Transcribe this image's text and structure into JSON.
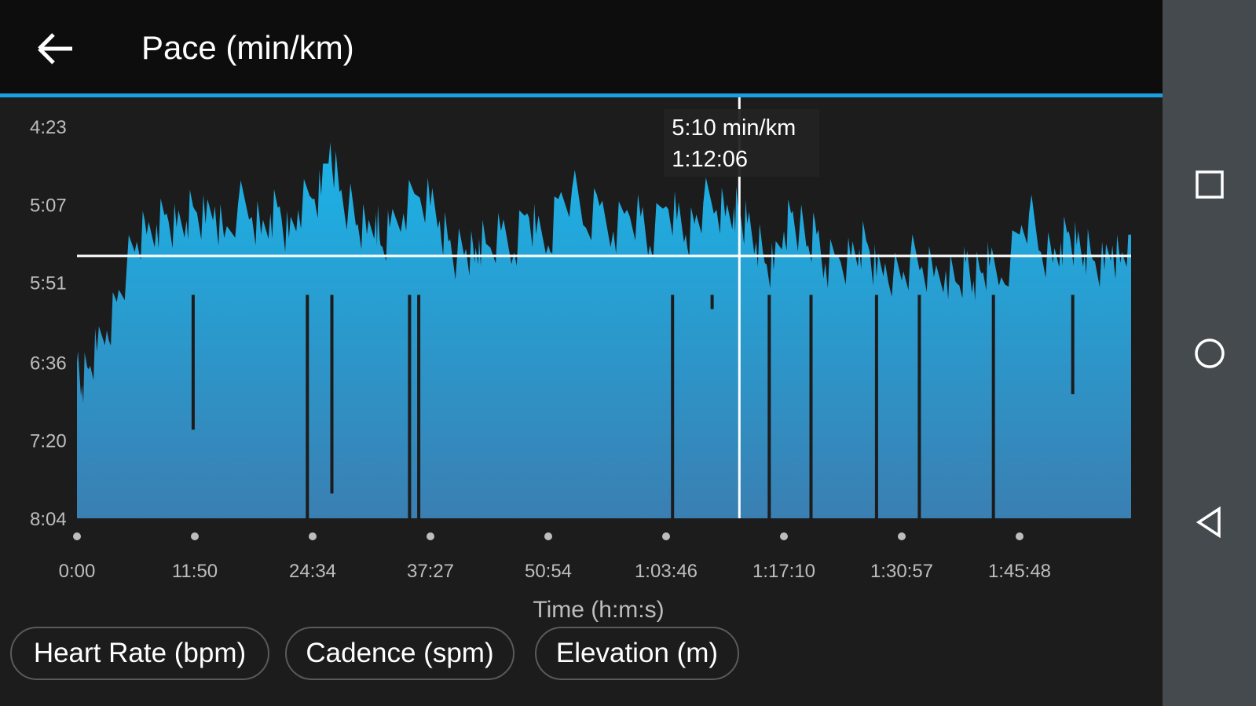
{
  "app_bar": {
    "title": "Pace (min/km)",
    "back_icon": "arrow-left-icon"
  },
  "chart_data": {
    "type": "area",
    "title": "Pace (min/km)",
    "xlabel": "Time (h:m:s)",
    "ylabel": "",
    "y_ticks": [
      "4:23",
      "5:07",
      "5:51",
      "6:36",
      "7:20",
      "8:04"
    ],
    "x_ticks": [
      "0:00",
      "11:50",
      "24:34",
      "37:27",
      "50:54",
      "1:03:46",
      "1:17:10",
      "1:30:57",
      "1:45:48"
    ],
    "y_inverted": true,
    "grid": false,
    "average_line": true,
    "tooltip": {
      "value": "5:10 min/km",
      "time": "1:12:06"
    },
    "series": [
      {
        "color": "#1ba8dd",
        "x": [
          "0:00",
          "0:30",
          "1:10",
          "2:00",
          "3:00",
          "4:00",
          "5:00",
          "6:00",
          "7:00",
          "8:00",
          "9:00",
          "10:00",
          "11:00",
          "11:50",
          "13:00",
          "14:00",
          "15:00",
          "16:30",
          "18:00",
          "19:00",
          "20:00",
          "21:00",
          "22:00",
          "23:00",
          "24:34",
          "25:30",
          "26:30",
          "27:30",
          "28:30",
          "29:30",
          "30:30",
          "31:30",
          "32:00",
          "33:00",
          "34:30",
          "36:00",
          "37:27",
          "38:30",
          "39:30",
          "40:30",
          "41:30",
          "42:30",
          "43:00",
          "44:00",
          "45:30",
          "47:00",
          "48:30",
          "49:30",
          "50:54",
          "52:00",
          "53:30",
          "55:00",
          "56:30",
          "58:00",
          "59:30",
          "1:01:00",
          "1:02:00",
          "1:03:46",
          "1:05:00",
          "1:06:00",
          "1:07:00",
          "1:08:00",
          "1:09:30",
          "1:10:30",
          "1:11:30",
          "1:12:06",
          "1:13:00",
          "1:14:00",
          "1:15:00",
          "1:16:00",
          "1:17:10",
          "1:18:00",
          "1:19:00",
          "1:20:00",
          "1:21:00",
          "1:22:00",
          "1:23:30",
          "1:25:00",
          "1:26:00",
          "1:27:00",
          "1:28:00",
          "1:29:00",
          "1:30:57",
          "1:32:00",
          "1:33:30",
          "1:35:00",
          "1:36:30",
          "1:38:00",
          "1:39:00",
          "1:40:00",
          "1:41:00",
          "1:42:00",
          "1:43:30",
          "1:45:48",
          "1:47:00",
          "1:48:30",
          "1:50:00",
          "1:51:00",
          "1:52:00",
          "1:53:00",
          "1:54:00",
          "1:55:00",
          "1:56:30",
          "1:57:30",
          "1:58:30",
          "1:59:30"
        ],
        "values": [
          "6:36",
          "6:49",
          "6:40",
          "6:30",
          "6:18",
          "6:02",
          "5:42",
          "5:28",
          "5:24",
          "5:18",
          "5:12",
          "5:20",
          "5:16",
          "5:10",
          "5:18",
          "5:08",
          "5:26",
          "5:07",
          "5:14",
          "5:24",
          "5:12",
          "5:08",
          "5:26",
          "5:10",
          "5:04",
          "5:02",
          "4:32",
          "5:00",
          "5:08",
          "5:18",
          "5:24",
          "5:12",
          "5:30",
          "5:20",
          "5:12",
          "5:02",
          "5:08",
          "5:16",
          "5:28",
          "5:36",
          "5:32",
          "5:40",
          "5:26",
          "5:30",
          "5:22",
          "5:34",
          "5:12",
          "5:24",
          "5:30",
          "5:04",
          "4:58",
          "5:20",
          "5:08",
          "5:22",
          "5:10",
          "5:14",
          "5:30",
          "5:08",
          "5:16",
          "5:24",
          "5:18",
          "5:06",
          "5:10",
          "5:14",
          "5:08",
          "5:10",
          "5:18",
          "5:28",
          "5:40",
          "5:44",
          "5:22",
          "5:12",
          "5:20",
          "5:30",
          "5:24",
          "5:40",
          "5:36",
          "5:38",
          "5:32",
          "5:30",
          "5:48",
          "5:40",
          "5:50",
          "5:38",
          "5:42",
          "5:48",
          "5:44",
          "5:52",
          "5:40",
          "5:50",
          "5:46",
          "5:42",
          "5:48",
          "5:24",
          "5:12",
          "5:34",
          "5:40",
          "5:28",
          "5:22",
          "5:30",
          "5:34",
          "5:38",
          "5:44",
          "5:30",
          "5:40",
          "5:24"
        ]
      }
    ]
  },
  "chips": [
    {
      "label": "Heart Rate (bpm)"
    },
    {
      "label": "Cadence (spm)"
    },
    {
      "label": "Elevation (m)"
    }
  ],
  "nav": {
    "recents_icon": "square-icon",
    "home_icon": "circle-icon",
    "back_icon": "triangle-back-icon"
  }
}
